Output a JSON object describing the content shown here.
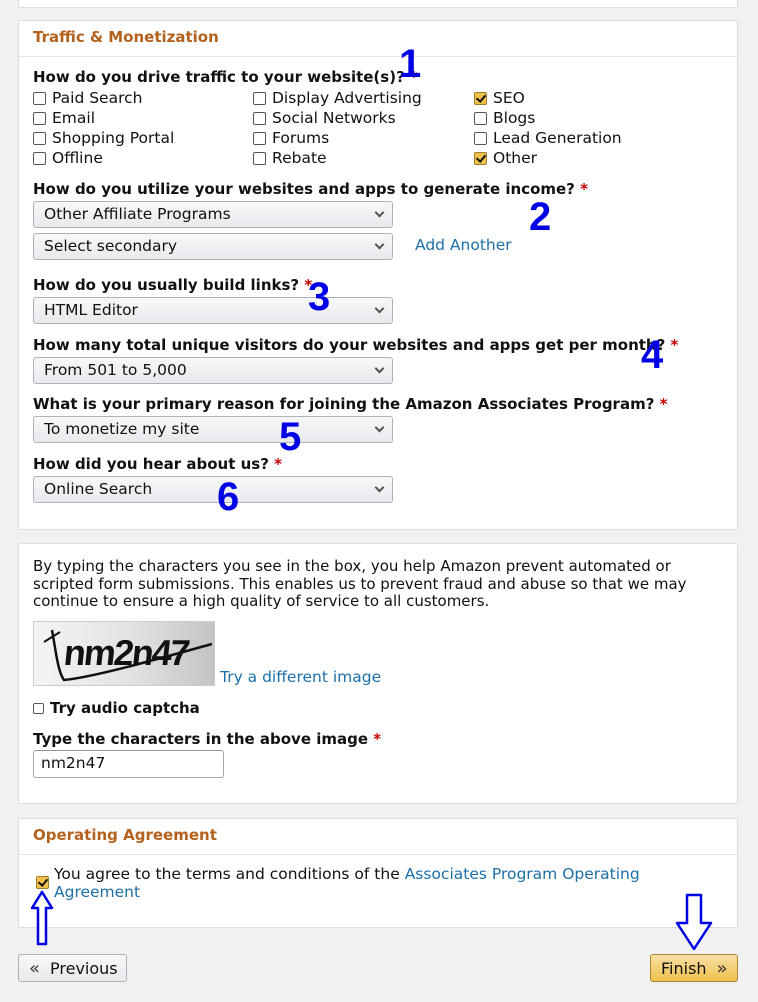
{
  "traffic_section": {
    "title": "Traffic & Monetization",
    "q1": {
      "label": "How do you drive traffic to your website(s)?",
      "required_mark": "*",
      "options": [
        {
          "label": "Paid Search",
          "checked": false
        },
        {
          "label": "Display Advertising",
          "checked": false
        },
        {
          "label": "SEO",
          "checked": true
        },
        {
          "label": "Email",
          "checked": false
        },
        {
          "label": "Social Networks",
          "checked": false
        },
        {
          "label": "Blogs",
          "checked": false
        },
        {
          "label": "Shopping Portal",
          "checked": false
        },
        {
          "label": "Forums",
          "checked": false
        },
        {
          "label": "Lead Generation",
          "checked": false
        },
        {
          "label": "Offline",
          "checked": false
        },
        {
          "label": "Rebate",
          "checked": false
        },
        {
          "label": "Other",
          "checked": true
        }
      ]
    },
    "q2": {
      "label": "How do you utilize your websites and apps to generate income?",
      "required_mark": "*",
      "primary_value": "Other Affiliate Programs",
      "secondary_value": "Select secondary",
      "add_another": "Add Another"
    },
    "q3": {
      "label": "How do you usually build links?",
      "required_mark": "*",
      "value": "HTML Editor"
    },
    "q4": {
      "label": "How many total unique visitors do your websites and apps get per month?",
      "required_mark": "*",
      "value": "From 501 to 5,000"
    },
    "q5": {
      "label": "What is your primary reason for joining the Amazon Associates Program?",
      "required_mark": "*",
      "value": "To monetize my site"
    },
    "q6": {
      "label": "How did you hear about us?",
      "required_mark": "*",
      "value": "Online Search"
    }
  },
  "annotations": {
    "n1": "1",
    "n2": "2",
    "n3": "3",
    "n4": "4",
    "n5": "5",
    "n6": "6"
  },
  "captcha_section": {
    "description": "By typing the characters you see in the box, you help Amazon prevent automated or scripted form submissions. This enables us to prevent fraud and abuse so that we may continue to ensure a high quality of service to all customers.",
    "captcha_text": "nm2n47",
    "try_different": "Try a different image",
    "audio_label": "Try audio captcha",
    "input_label": "Type the characters in the above image",
    "required_mark": "*",
    "input_value": "nm2n47"
  },
  "agreement_section": {
    "title": "Operating Agreement",
    "agree_text": "You agree to the terms and conditions of the",
    "agree_link": "Associates Program Operating Agreement",
    "checked": true
  },
  "footer": {
    "previous_label": "Previous",
    "finish_label": "Finish"
  },
  "colors": {
    "accent": "#b4611d",
    "link": "#1c6fa8",
    "annotation": "#0000e6",
    "finish_bg": "#f0c14b"
  },
  "icons": [
    "checkbox-icon",
    "chevron-down-icon",
    "double-chevron-left-icon",
    "double-chevron-right-icon",
    "up-arrow-icon",
    "down-arrow-icon"
  ]
}
